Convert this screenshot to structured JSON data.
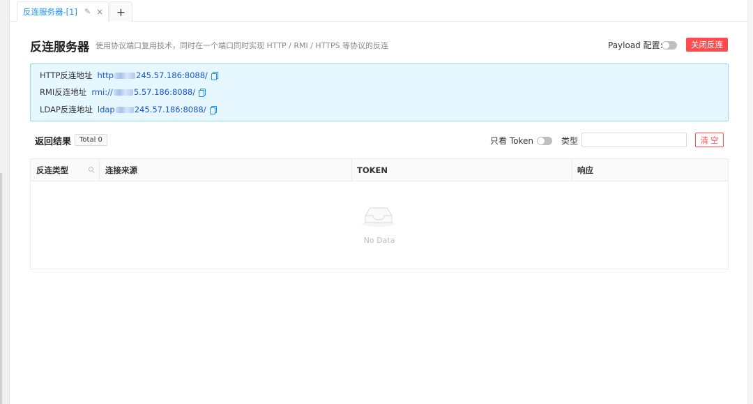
{
  "tab": {
    "title": "反连服务器-[1]",
    "edit_icon": "pencil-icon",
    "close_label": "×",
    "add_label": "+"
  },
  "header": {
    "title": "反连服务器",
    "description": "使用协议端口复用技术，同时在一个端口同时实现 HTTP / RMI / HTTPS 等协议的反连",
    "payload_label": "Payload 配置:",
    "payload_enabled": false,
    "close_button": "关闭反连"
  },
  "addresses": {
    "http": {
      "label": "HTTP反连地址",
      "prefix": "http",
      "suffix": "245.57.186:8088/"
    },
    "rmi": {
      "label": "RMI反连地址",
      "prefix": "rmi://",
      "suffix": "5.57.186:8088/"
    },
    "ldap": {
      "label": "LDAP反连地址",
      "prefix": "ldap",
      "suffix": "245.57.186:8088/"
    },
    "copy_icon": "copy-icon"
  },
  "results": {
    "title": "返回结果",
    "total": "Total 0",
    "only_token_label": "只看 Token",
    "only_token_enabled": false,
    "type_label": "类型",
    "type_value": "",
    "clear_button": "清空"
  },
  "table": {
    "columns": [
      "反连类型",
      "连接来源",
      "TOKEN",
      "响应"
    ],
    "rows": [],
    "empty_text": "No Data"
  },
  "colors": {
    "accent": "#1890ff",
    "danger": "#ff4d4f",
    "panel_bg": "#e6f7ff",
    "panel_border": "#91d5ff"
  }
}
